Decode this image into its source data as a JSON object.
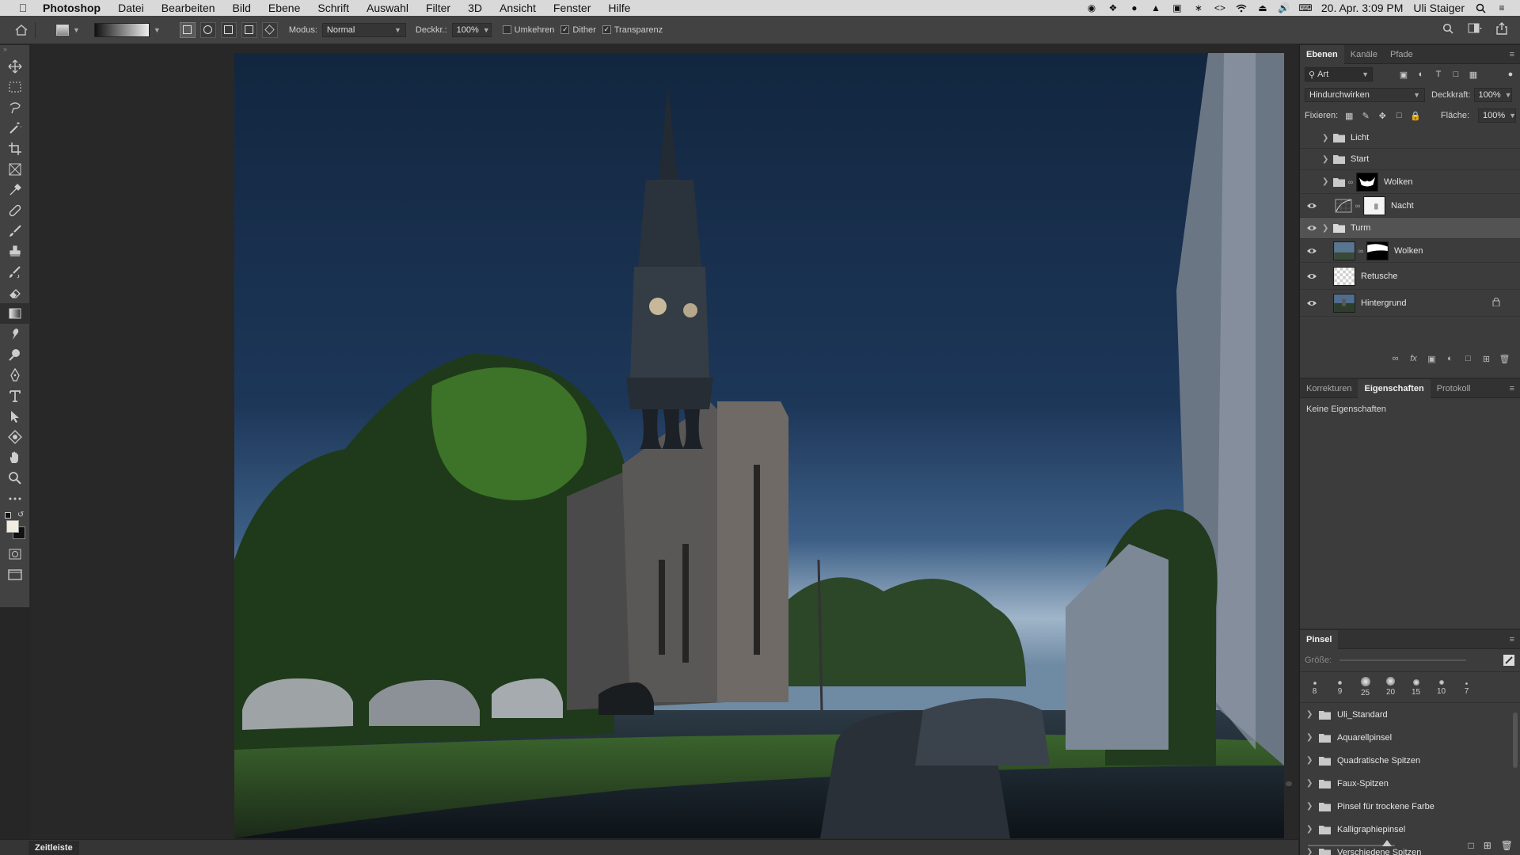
{
  "menubar": {
    "app": "Photoshop",
    "items": [
      "Datei",
      "Bearbeiten",
      "Bild",
      "Ebene",
      "Schrift",
      "Auswahl",
      "Filter",
      "3D",
      "Ansicht",
      "Fenster",
      "Hilfe"
    ],
    "clock": "20. Apr.  3:09 PM",
    "user": "Uli Staiger"
  },
  "options": {
    "modus_label": "Modus:",
    "modus_value": "Normal",
    "deckkraft_label": "Deckkr.:",
    "deckkraft_value": "100%",
    "umkehren": "Umkehren",
    "dither": "Dither",
    "transparenz": "Transparenz"
  },
  "layers_panel": {
    "tabs": [
      "Ebenen",
      "Kanäle",
      "Pfade"
    ],
    "kind": "Art",
    "blend_mode": "Hindurchwirken",
    "opacity_label": "Deckkraft:",
    "opacity_value": "100%",
    "lock_label": "Fixieren:",
    "fill_label": "Fläche:",
    "fill_value": "100%",
    "layers": [
      {
        "name": "Licht",
        "type": "group",
        "visible": false
      },
      {
        "name": "Start",
        "type": "group",
        "visible": false
      },
      {
        "name": "Wolken",
        "type": "group-masked",
        "visible": false
      },
      {
        "name": "Nacht",
        "type": "adjustment",
        "visible": true
      },
      {
        "name": "Turm",
        "type": "group",
        "visible": true,
        "selected": true
      },
      {
        "name": "Wolken",
        "type": "image-masked",
        "visible": true
      },
      {
        "name": "Retusche",
        "type": "transparent",
        "visible": true
      },
      {
        "name": "Hintergrund",
        "type": "background",
        "visible": true,
        "locked": true
      }
    ]
  },
  "properties_panel": {
    "tabs": [
      "Korrekturen",
      "Eigenschaften",
      "Protokoll"
    ],
    "empty_text": "Keine Eigenschaften"
  },
  "brush_panel": {
    "title": "Pinsel",
    "size_label": "Größe:",
    "presets": [
      8,
      9,
      25,
      20,
      15,
      10,
      7
    ],
    "folders": [
      "Uli_Standard",
      "Aquarellpinsel",
      "Quadratische Spitzen",
      "Faux-Spitzen",
      "Pinsel für trockene Farbe",
      "Kalligraphiepinsel",
      "Verschiedene Spitzen"
    ]
  },
  "statusbar": {
    "timeline": "Zeitleiste"
  },
  "colors": {
    "foreground": "#f0ece0",
    "background": "#111111",
    "panel": "#3c3c3c",
    "selected_layer": "#535353"
  }
}
